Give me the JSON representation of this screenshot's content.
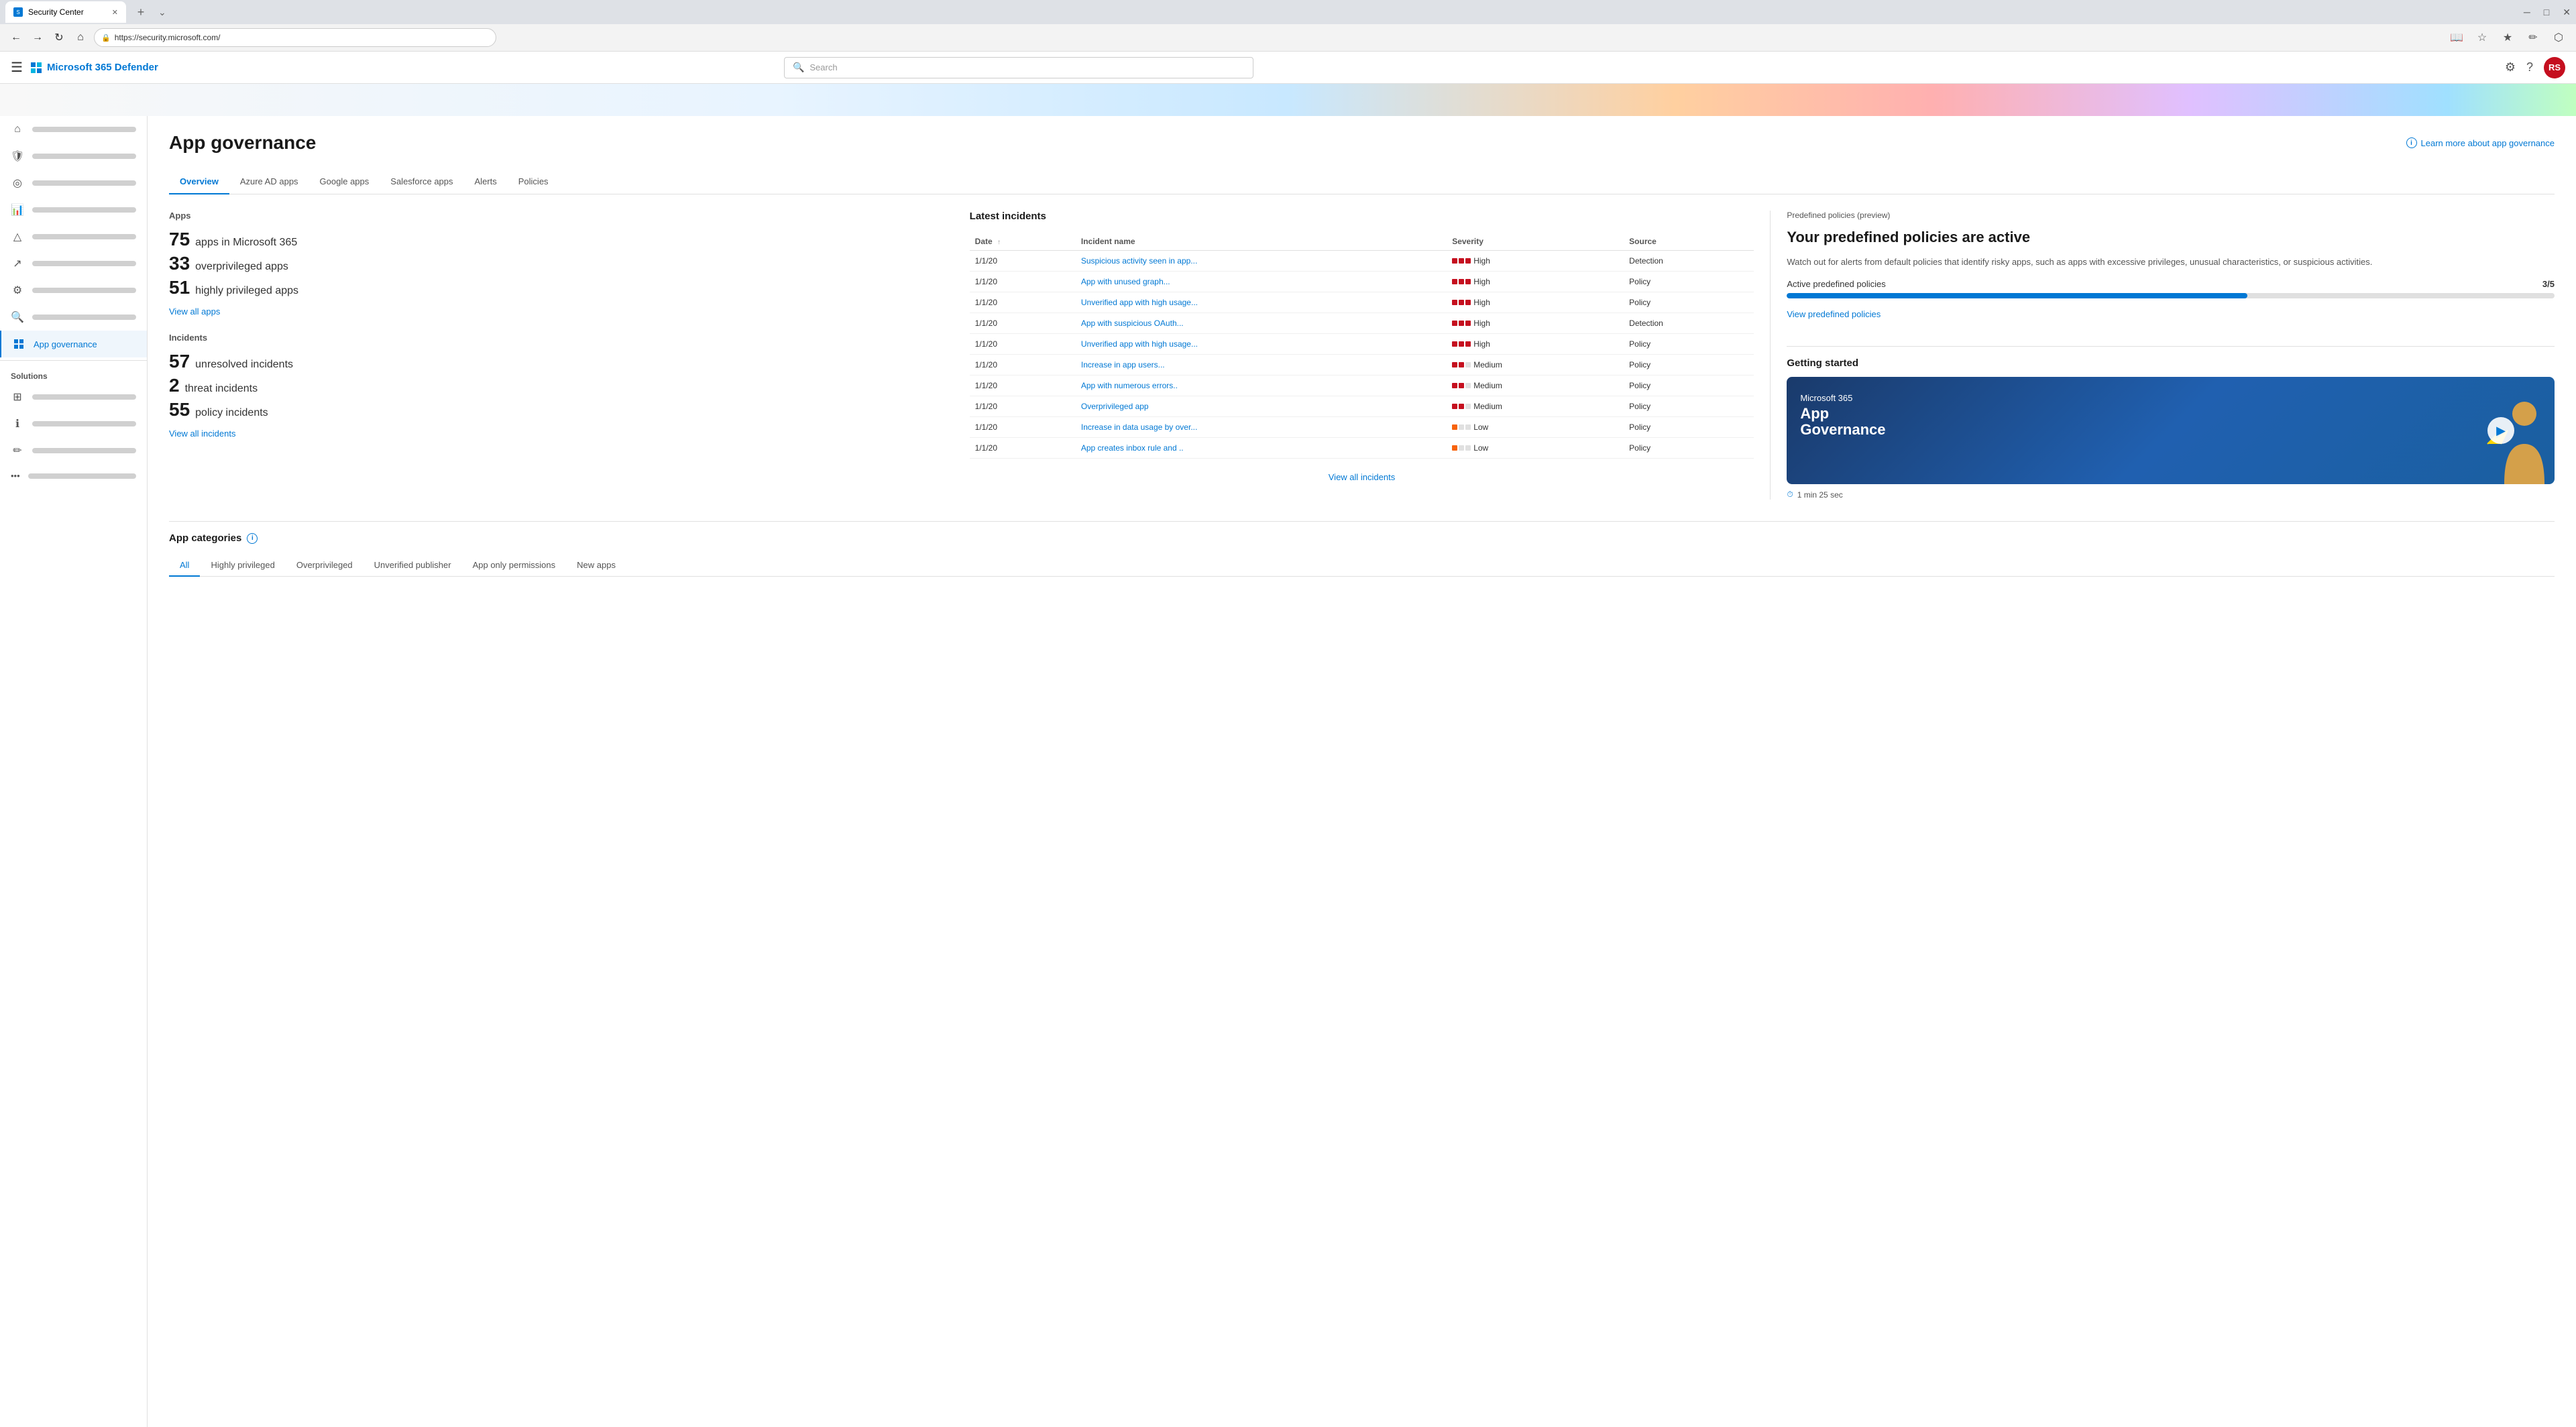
{
  "browser": {
    "tab_title": "Security Center",
    "url": "https://security.microsoft.com/",
    "new_tab_label": "+",
    "nav_back": "←",
    "nav_forward": "→",
    "nav_refresh": "↻",
    "nav_home": "⌂"
  },
  "app": {
    "brand": "Microsoft 365 Defender",
    "search_placeholder": "Search"
  },
  "sidebar": {
    "items": [
      {
        "id": "home",
        "icon": "⌂",
        "label": ""
      },
      {
        "id": "incidents",
        "icon": "🛡",
        "label": ""
      },
      {
        "id": "hunting",
        "icon": "🎯",
        "label": ""
      },
      {
        "id": "reports",
        "icon": "📊",
        "label": ""
      },
      {
        "id": "alerts",
        "icon": "🔔",
        "label": ""
      },
      {
        "id": "partners",
        "icon": "🔧",
        "label": ""
      },
      {
        "id": "search2",
        "icon": "🔍",
        "label": ""
      },
      {
        "id": "app_governance",
        "icon": "□",
        "label": "App governance"
      }
    ],
    "solutions_label": "Solutions",
    "solutions_items": [
      {
        "id": "sol1",
        "icon": "⊞",
        "label": ""
      },
      {
        "id": "sol2",
        "icon": "ℹ",
        "label": ""
      },
      {
        "id": "sol3",
        "icon": "✏",
        "label": ""
      }
    ],
    "more_label": "..."
  },
  "page": {
    "title": "App governance",
    "learn_more": "Learn more about app governance",
    "tabs": [
      {
        "id": "overview",
        "label": "Overview",
        "active": true
      },
      {
        "id": "azure_ad",
        "label": "Azure AD apps"
      },
      {
        "id": "google",
        "label": "Google apps"
      },
      {
        "id": "salesforce",
        "label": "Salesforce apps"
      },
      {
        "id": "alerts",
        "label": "Alerts"
      },
      {
        "id": "policies",
        "label": "Policies"
      }
    ]
  },
  "apps_stats": {
    "heading": "Apps",
    "stats": [
      {
        "number": "75",
        "label": "apps in Microsoft 365"
      },
      {
        "number": "33",
        "label": "overprivileged apps"
      },
      {
        "number": "51",
        "label": "highly privileged apps"
      }
    ],
    "view_all": "View all apps"
  },
  "incidents_stats": {
    "heading": "Incidents",
    "stats": [
      {
        "number": "57",
        "label": "unresolved incidents"
      },
      {
        "number": "2",
        "label": "threat incidents"
      },
      {
        "number": "55",
        "label": "policy incidents"
      }
    ],
    "view_all": "View all incidents"
  },
  "latest_incidents": {
    "heading": "Latest incidents",
    "columns": [
      {
        "id": "date",
        "label": "Date",
        "sortable": true
      },
      {
        "id": "name",
        "label": "Incident name"
      },
      {
        "id": "severity",
        "label": "Severity"
      },
      {
        "id": "source",
        "label": "Source"
      }
    ],
    "rows": [
      {
        "date": "1/1/20",
        "name": "Suspicious activity seen in app...",
        "severity": "High",
        "severity_level": "high",
        "source": "Detection"
      },
      {
        "date": "1/1/20",
        "name": "App with unused graph...",
        "severity": "High",
        "severity_level": "high",
        "source": "Policy"
      },
      {
        "date": "1/1/20",
        "name": "Unverified app with high usage...",
        "severity": "High",
        "severity_level": "high",
        "source": "Policy"
      },
      {
        "date": "1/1/20",
        "name": "App with suspicious OAuth...",
        "severity": "High",
        "severity_level": "high",
        "source": "Detection"
      },
      {
        "date": "1/1/20",
        "name": "Unverified app with high usage...",
        "severity": "High",
        "severity_level": "high",
        "source": "Policy"
      },
      {
        "date": "1/1/20",
        "name": "Increase in app users...",
        "severity": "Medium",
        "severity_level": "medium",
        "source": "Policy"
      },
      {
        "date": "1/1/20",
        "name": "App with numerous errors..",
        "severity": "Medium",
        "severity_level": "medium",
        "source": "Policy"
      },
      {
        "date": "1/1/20",
        "name": "Overprivileged app",
        "severity": "Medium",
        "severity_level": "medium",
        "source": "Policy"
      },
      {
        "date": "1/1/20",
        "name": "Increase in data usage by over...",
        "severity": "Low",
        "severity_level": "low",
        "source": "Policy"
      },
      {
        "date": "1/1/20",
        "name": "App creates inbox rule and ..",
        "severity": "Low",
        "severity_level": "low",
        "source": "Policy"
      }
    ],
    "view_all": "View all incidents"
  },
  "predefined_policies": {
    "section_label": "Predefined policies (preview)",
    "heading": "Your predefined policies are active",
    "description": "Watch out for alerts from default policies that identify risky apps, such as apps with excessive privileges, unusual characteristics, or suspicious activities.",
    "progress_label": "Active predefined policies",
    "progress_current": 3,
    "progress_total": 5,
    "progress_percent": 60,
    "progress_display": "3/5",
    "view_link": "View predefined policies"
  },
  "getting_started": {
    "label": "Getting started",
    "video_ms365": "Microsoft 365",
    "video_title": "App\nGovernance",
    "video_duration": "1 min 25 sec",
    "video_play": "▶"
  },
  "app_categories": {
    "heading": "App categories",
    "tabs": [
      {
        "id": "all",
        "label": "All",
        "active": true
      },
      {
        "id": "highly_privileged",
        "label": "Highly privileged"
      },
      {
        "id": "overprivileged",
        "label": "Overprivileged"
      },
      {
        "id": "unverified",
        "label": "Unverified publisher"
      },
      {
        "id": "app_only",
        "label": "App only permissions"
      },
      {
        "id": "new_apps",
        "label": "New apps"
      }
    ]
  }
}
